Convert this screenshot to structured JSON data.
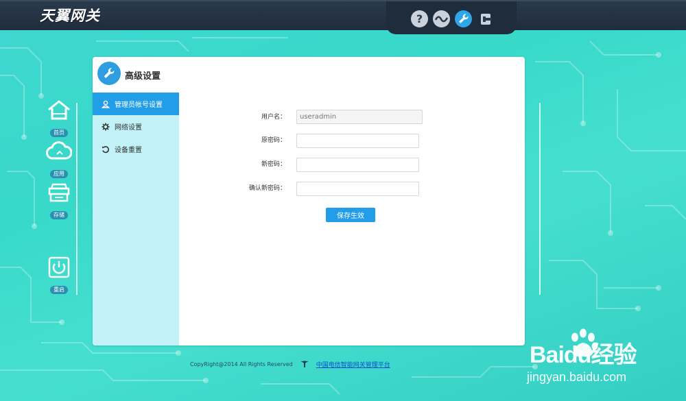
{
  "logo": {
    "text": "天翼网关"
  },
  "toolbar": {
    "icons": [
      "help-icon",
      "chart-wave-icon",
      "wrench-icon",
      "exit-icon"
    ]
  },
  "leftnav": {
    "items": [
      {
        "label": "首页",
        "icon": "home-icon"
      },
      {
        "label": "应用",
        "icon": "cloud-icon"
      },
      {
        "label": "存储",
        "icon": "storage-icon"
      },
      {
        "label": "重启",
        "icon": "power-icon"
      }
    ]
  },
  "panel": {
    "title": "高级设置",
    "menu": [
      {
        "label": "管理员帐号设置",
        "icon": "user-icon",
        "active": true
      },
      {
        "label": "网络设置",
        "icon": "gear-icon",
        "active": false
      },
      {
        "label": "设备重置",
        "icon": "reset-icon",
        "active": false
      }
    ],
    "form": {
      "username_label": "用户名：",
      "username_value": "useradmin",
      "old_password_label": "原密码：",
      "old_password_value": "",
      "new_password_label": "新密码：",
      "new_password_value": "",
      "confirm_password_label": "确认新密码：",
      "confirm_password_value": "",
      "save_label": "保存生效"
    }
  },
  "footer": {
    "copyright": "CopyRight@2014 All Rights Reserved",
    "link": "中国电信智能网关管理平台"
  },
  "watermark": {
    "brand": "Baidu经验",
    "url": "jingyan.baidu.com"
  },
  "colors": {
    "accent": "#229ee8",
    "topbar": "#1f2c3b",
    "menu_bg": "#c2f1f7"
  }
}
